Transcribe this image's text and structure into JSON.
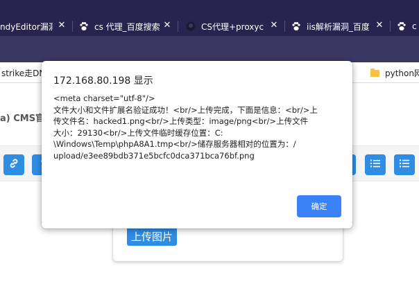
{
  "browser": {
    "tabs": [
      {
        "title": "ndyEditor漏洞",
        "favicon": "none"
      },
      {
        "title": "cs 代理_百度搜索",
        "favicon": "baidu-paw-icon"
      },
      {
        "title": "CS代理+proxyc",
        "favicon": "github-icon"
      },
      {
        "title": "iis解析漏洞_百度",
        "favicon": "baidu-paw-icon"
      },
      {
        "title": "c",
        "favicon": "baidu-paw-icon"
      }
    ],
    "close_glyph": "✕"
  },
  "bookmarks": [
    {
      "label": "strike走DN"
    },
    {
      "label": "python网"
    }
  ],
  "page": {
    "title_fragment": "a) CMS官",
    "upload_button": "上传图片"
  },
  "dialog": {
    "title": "172.168.80.198 显示",
    "message_lines": [
      "<meta charset=\"utf-8\"/>",
      "文件大小和文件扩展名验证成功！<br/>上传完成，下面是信息：<br/>上",
      "传文件名：hacked1.png<br/>上传类型：image/png<br/>上传文件",
      "大小：29130<br/>上传文件临时缓存位置：C:",
      "\\Windows\\Temp\\phpA8A1.tmp<br/>储存服务器相对的位置为：/",
      "upload/e3ee89bdb371e5bcfc0dca371bca76bf.png"
    ],
    "ok_button": "确定"
  },
  "colors": {
    "tabbar_bg": "#27244f",
    "toolbar_bg": "#3b3763",
    "accent_blue": "#2f8de4",
    "dialog_button": "#3b82f6"
  }
}
